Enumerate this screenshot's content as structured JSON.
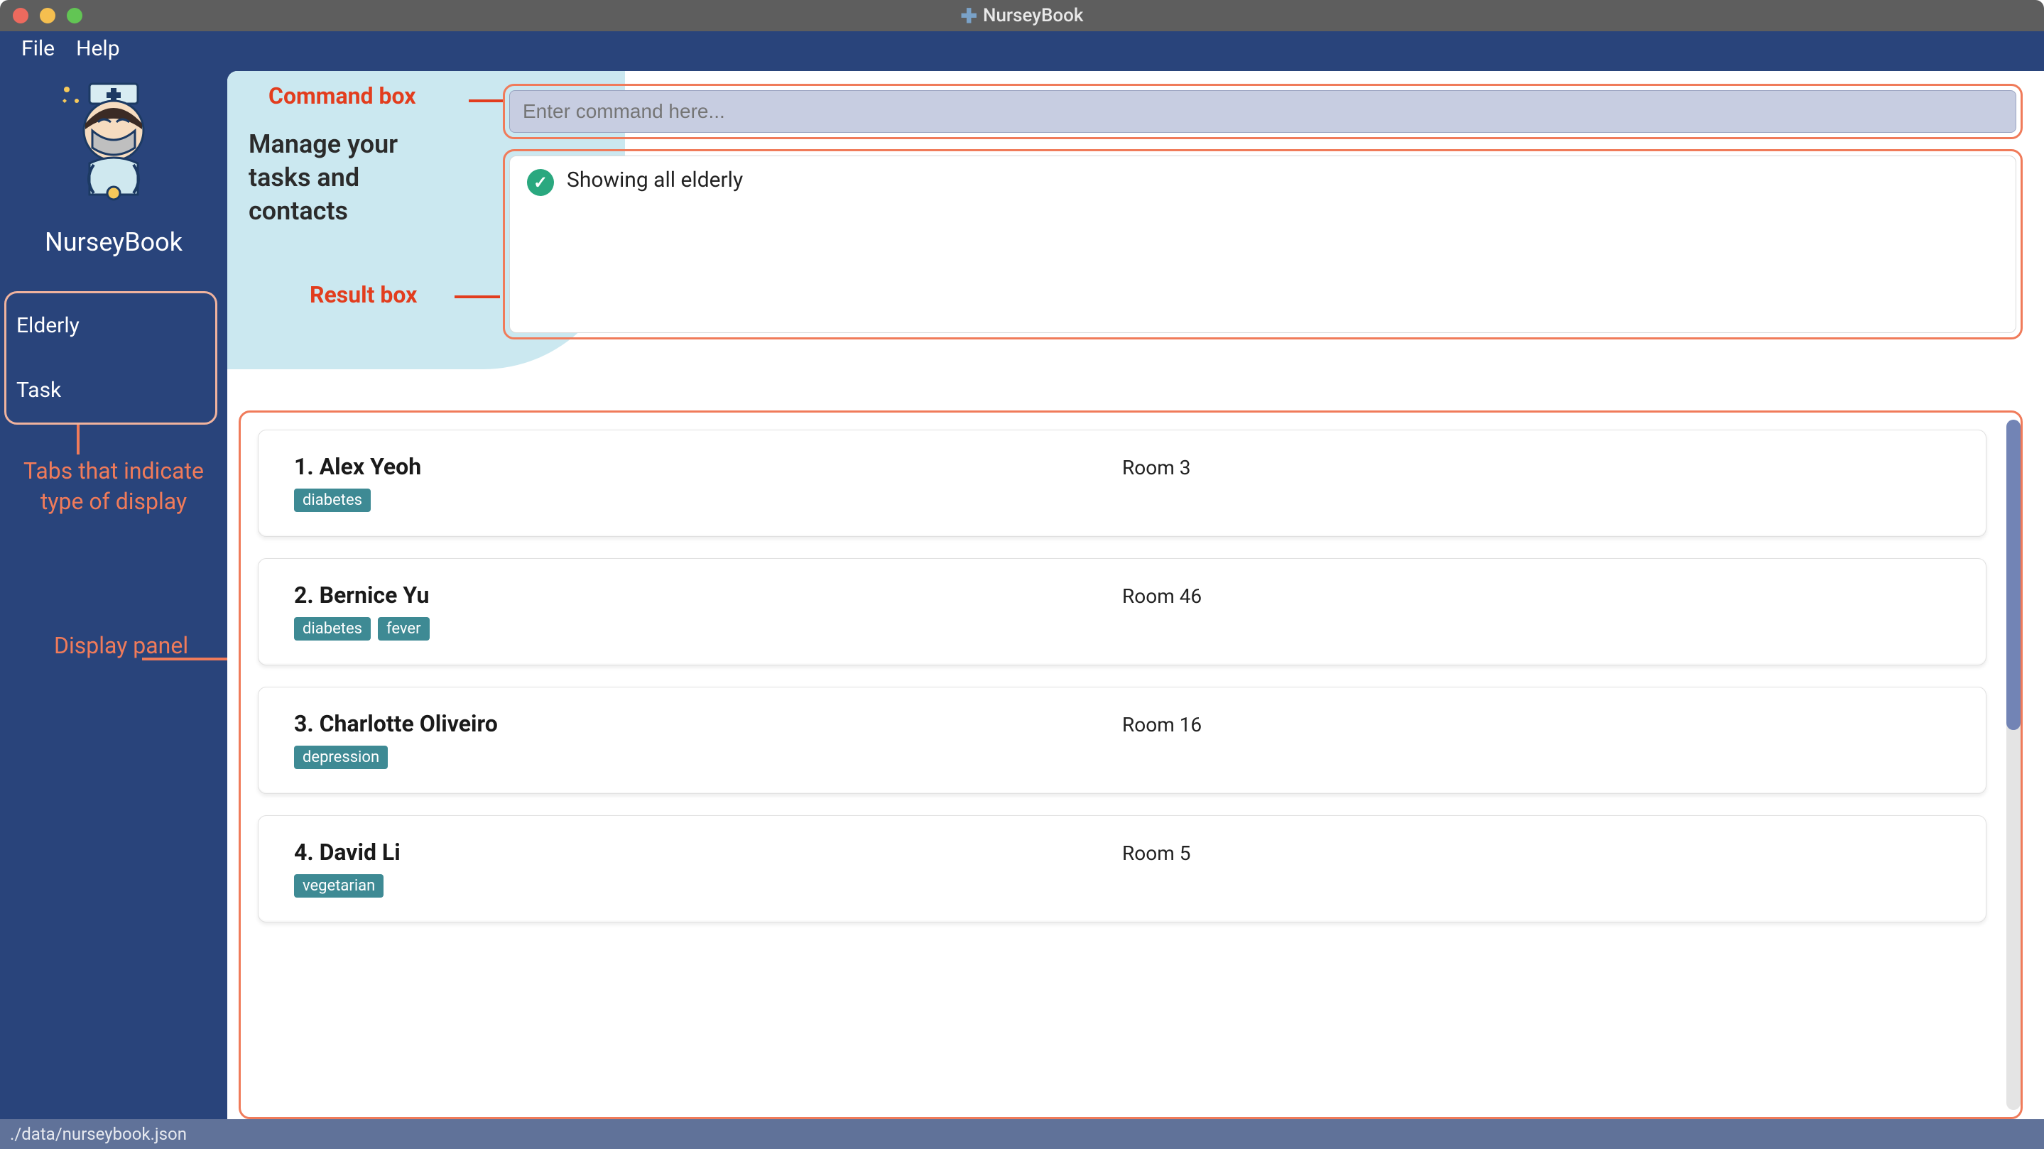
{
  "window": {
    "title": "NurseyBook"
  },
  "menu": {
    "file": "File",
    "help": "Help"
  },
  "sidebar": {
    "app_name": "NurseyBook",
    "tabs": [
      {
        "label": "Elderly"
      },
      {
        "label": "Task"
      }
    ]
  },
  "annotations": {
    "command_box": "Command box",
    "result_box": "Result box",
    "tabs": "Tabs that indicate type of display",
    "display_panel": "Display panel"
  },
  "header": {
    "manage_text": "Manage your tasks and contacts"
  },
  "command": {
    "placeholder": "Enter command here..."
  },
  "result": {
    "text": "Showing all elderly"
  },
  "cards": [
    {
      "title": "1. Alex Yeoh",
      "tags": [
        "diabetes"
      ],
      "room": "Room 3"
    },
    {
      "title": "2. Bernice Yu",
      "tags": [
        "diabetes",
        "fever"
      ],
      "room": "Room 46"
    },
    {
      "title": "3. Charlotte Oliveiro",
      "tags": [
        "depression"
      ],
      "room": "Room 16"
    },
    {
      "title": "4. David Li",
      "tags": [
        "vegetarian"
      ],
      "room": "Room 5"
    }
  ],
  "status": {
    "path": "./data/nurseybook.json"
  }
}
